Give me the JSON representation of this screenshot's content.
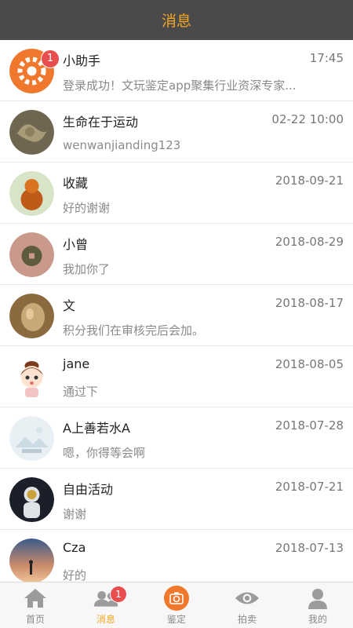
{
  "header": {
    "title": "消息"
  },
  "messages": [
    {
      "name": "小助手",
      "time": "17:45",
      "preview": "登录成功！文玩鉴定app聚集行业资深专家...",
      "badge": "1",
      "avatar": "assistant-logo"
    },
    {
      "name": "生命在于运动",
      "time": "02-22 10:00",
      "preview": "wenwanjianding123",
      "avatar": "dragon-carving"
    },
    {
      "name": "收藏",
      "time": "2018-09-21",
      "preview": "好的谢谢",
      "avatar": "amber-buddha"
    },
    {
      "name": "小曾",
      "time": "2018-08-29",
      "preview": "我加你了",
      "avatar": "coin-in-hand"
    },
    {
      "name": "文",
      "time": "2018-08-17",
      "preview": "积分我们在审核完后会加。",
      "avatar": "carved-gourd"
    },
    {
      "name": "jane",
      "time": "2018-08-05",
      "preview": "通过下",
      "avatar": "cartoon-girl"
    },
    {
      "name": "A上善若水A",
      "time": "2018-07-28",
      "preview": "嗯，你得等会啊",
      "avatar": "default-placeholder"
    },
    {
      "name": "自由活动",
      "time": "2018-07-21",
      "preview": "谢谢",
      "avatar": "astronaut"
    },
    {
      "name": "Cza",
      "time": "2018-07-13",
      "preview": "好的",
      "avatar": "sunset-figure"
    }
  ],
  "tabbar": {
    "tabs": [
      {
        "label": "首页",
        "icon": "home-icon"
      },
      {
        "label": "消息",
        "icon": "contacts-icon",
        "badge": "1",
        "active": true
      },
      {
        "label": "鉴定",
        "icon": "camera-icon"
      },
      {
        "label": "拍卖",
        "icon": "eye-icon"
      },
      {
        "label": "我的",
        "icon": "user-icon"
      }
    ]
  },
  "colors": {
    "accent": "#f5a623",
    "header_bg": "#4a4a4a",
    "badge": "#e94e4e"
  }
}
